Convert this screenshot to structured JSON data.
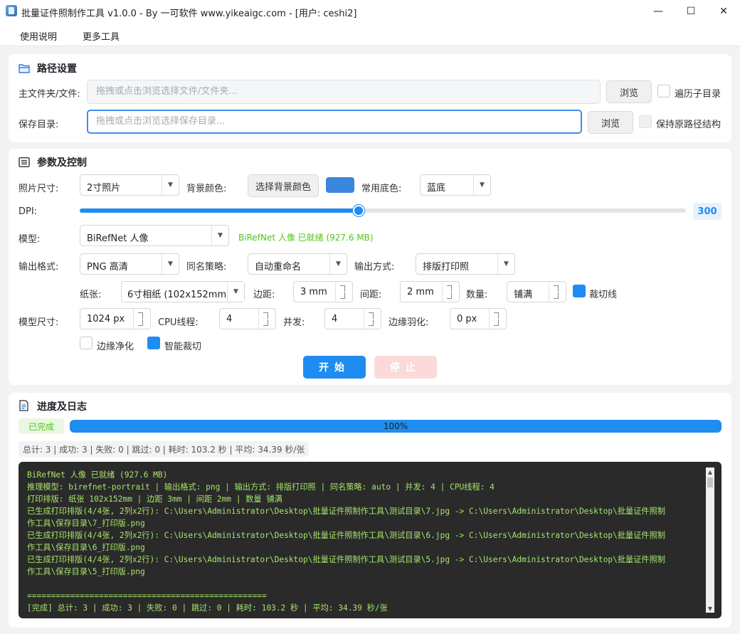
{
  "window": {
    "title": "批量证件照制作工具 v1.0.0 - By 一可软件 www.yikeaigc.com - [用户: ceshi2]",
    "minimize": "—",
    "maximize": "☐",
    "close": "✕"
  },
  "menu": [
    "使用说明",
    "更多工具"
  ],
  "path_section": {
    "title": "路径设置",
    "main_label": "主文件夹/文件:",
    "main_placeholder": "拖拽或点击浏览选择文件/文件夹...",
    "browse_label": "浏览",
    "recursive_label": "遍历子目录",
    "recursive_checked": false,
    "save_label": "保存目录:",
    "save_placeholder": "拖拽或点击浏览选择保存目录...",
    "save_browse_label": "浏览",
    "keep_structure_label": "保持原路径结构",
    "keep_structure_checked": false
  },
  "params_section": {
    "title": "参数及控制",
    "photo_size_label": "照片尺寸:",
    "photo_size_value": "2寸照片",
    "bg_color_label": "背景颜色:",
    "bg_color_button": "选择背景颜色",
    "bg_color_hex": "#3a86dc",
    "common_bg_label": "常用底色:",
    "common_bg_value": "蓝底",
    "dpi_label": "DPI:",
    "dpi_value": "300",
    "dpi_fraction": 0.4605,
    "model_label": "模型:",
    "model_value": "BiRefNet 人像",
    "model_status": "BiRefNet 人像 已就绪 (927.6 MB)",
    "output_format_label": "输出格式:",
    "output_format_value": "PNG 高清",
    "naming_label": "同名策略:",
    "naming_value": "自动重命名",
    "output_mode_label": "输出方式:",
    "output_mode_value": "排版打印照",
    "paper_label": "纸张:",
    "paper_value": "6寸相纸 (102x152mm",
    "margin_label": "边距:",
    "margin_value": "3 mm",
    "gap_label": "间距:",
    "gap_value": "2 mm",
    "count_label": "数量:",
    "count_value": "铺满",
    "cutline_label": "裁切线",
    "cutline_checked": true,
    "model_size_label": "模型尺寸:",
    "model_size_value": "1024 px",
    "cpu_threads_label": "CPU线程:",
    "cpu_threads_value": "4",
    "concurrency_label": "并发:",
    "concurrency_value": "4",
    "feather_label": "边缘羽化:",
    "feather_value": "0 px",
    "edge_clean_label": "边缘净化",
    "edge_clean_checked": false,
    "smart_crop_label": "智能裁切",
    "smart_crop_checked": true,
    "start_label": "开始",
    "stop_label": "停止"
  },
  "progress_section": {
    "title": "进度及日志",
    "status_badge": "已完成",
    "progress_percent": 100,
    "progress_text": "100%",
    "stats": "总计: 3 | 成功: 3 | 失败: 0 | 跳过: 0 | 耗时: 103.2 秒 | 平均: 34.39 秒/张",
    "log_lines": [
      "BiRefNet 人像 已就绪 (927.6 MB)",
      "推理模型: birefnet-portrait | 输出格式: png | 输出方式: 排版打印照 | 同名策略: auto | 并发: 4 | CPU线程: 4",
      "打印排版: 纸张 102x152mm | 边距 3mm | 间距 2mm | 数量 铺满",
      "已生成打印排版(4/4张, 2列x2行): C:\\Users\\Administrator\\Desktop\\批量证件照制作工具\\测试目录\\7.jpg -> C:\\Users\\Administrator\\Desktop\\批量证件照制",
      "作工具\\保存目录\\7_打印版.png",
      "已生成打印排版(4/4张, 2列x2行): C:\\Users\\Administrator\\Desktop\\批量证件照制作工具\\测试目录\\6.jpg -> C:\\Users\\Administrator\\Desktop\\批量证件照制",
      "作工具\\保存目录\\6_打印版.png",
      "已生成打印排版(4/4张, 2列x2行): C:\\Users\\Administrator\\Desktop\\批量证件照制作工具\\测试目录\\5.jpg -> C:\\Users\\Administrator\\Desktop\\批量证件照制",
      "作工具\\保存目录\\5_打印版.png",
      "",
      "==================================================",
      "[完成] 总计: 3 | 成功: 3 | 失败: 0 | 跳过: 0 | 耗时: 103.2 秒 | 平均: 34.39 秒/张"
    ]
  }
}
